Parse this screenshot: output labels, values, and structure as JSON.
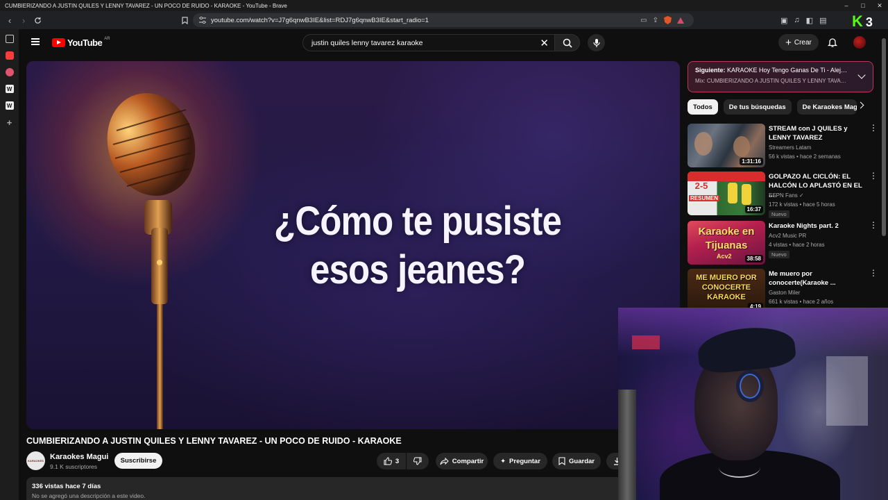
{
  "window": {
    "title": "CUMBIERIZANDO A JUSTIN QUILES Y LENNY TAVAREZ - UN POCO DE RUIDO - KARAOKE - YouTube - Brave",
    "controls": [
      "–",
      "□",
      "✕"
    ]
  },
  "browser": {
    "url": "youtube.com/watch?v=J7g6qnwB3IE&list=RDJ7g6qnwB3IE&start_radio=1",
    "kick_count": "3"
  },
  "youtube": {
    "logo_text": "YouTube",
    "country": "AR",
    "search_value": "justin quiles lenny tavarez karaoke",
    "create_label": "Crear"
  },
  "player": {
    "lyric": "¿Cómo te pusiste esos jeanes?"
  },
  "video": {
    "title": "CUMBIERIZANDO A JUSTIN QUILES Y LENNY TAVAREZ - UN POCO DE RUIDO - KARAOKE",
    "channel": "Karaokes Magui",
    "channel_avatar_text": "KARAOKES",
    "subscribers": "9.1 K suscriptores",
    "subscribe_label": "Suscribirse",
    "likes": "3",
    "share_label": "Compartir",
    "ask_label": "Preguntar",
    "save_label": "Guardar",
    "views_date": "336 vistas  hace 7 días",
    "description": "No se agregó una descripción a este video."
  },
  "up_next": {
    "label": "Siguiente:",
    "title": "KARAOKE Hoy Tengo Ganas De Ti - Aleja...",
    "mix": "Mix: CUMBIERIZANDO A JUSTIN QUILES Y LENNY TAVAREZ..."
  },
  "chips": [
    "Todos",
    "De tus búsquedas",
    "De Karaokes Magui"
  ],
  "recommendations": [
    {
      "title": "STREAM con J QUILES y LENNY TAVAREZ",
      "channel": "Streamers Latam",
      "meta": "56 k vistas • hace 2 semanas",
      "duration": "1:31:16",
      "badge": ""
    },
    {
      "title": "GOLPAZO AL CICLÓN: EL HALCÓN LO APLASTÓ EN EL ...",
      "channel": "ESPN Fans",
      "meta": "172 k vistas • hace 5 horas",
      "duration": "16:37",
      "badge": "Nuevo",
      "thumb_text": "RESUMEN",
      "score": "2-5"
    },
    {
      "title": "Karaoke Nights part. 2",
      "channel": "Acv2 Music PR",
      "meta": "4 vistas • hace 2 horas",
      "duration": "38:58",
      "badge": "Nuevo",
      "thumb_text": "Karaoke en Tijuanas",
      "thumb_sub": "Acv2"
    },
    {
      "title": "Me muero por conocerte(Karaoke ...",
      "channel": "Gaston Miler",
      "meta": "661 k vistas • hace 2 años",
      "duration": "4:19",
      "badge": "",
      "thumb_text": "ME MUERO POR CONOCERTE KARAOKE"
    }
  ]
}
